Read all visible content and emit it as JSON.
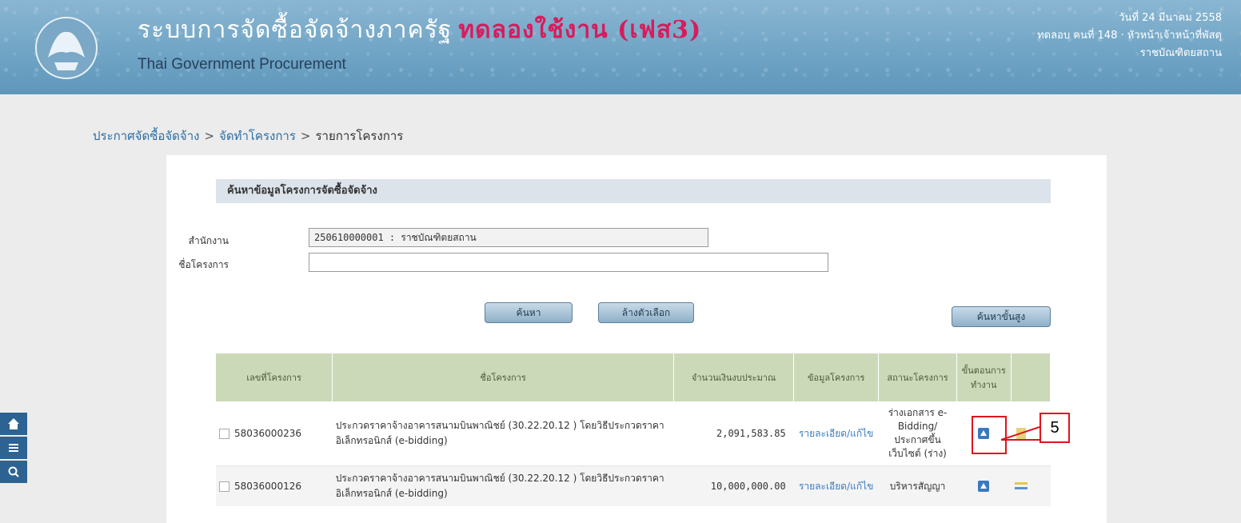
{
  "header": {
    "title_th": "ระบบการจัดซื้อจัดจ้างภาครัฐ",
    "title_tag": "ทดลองใช้งาน (เฟส3)",
    "title_en": "Thai Government Procurement",
    "date_line": "วันที่ 24 มีนาคม 2558",
    "user_line": "ทดลอบ คนที่ 148 · หัวหน้าเจ้าหน้าที่พัสดุ",
    "org_line": "ราชบัณฑิตยสถาน"
  },
  "breadcrumb": {
    "items": [
      "ประกาศจัดซื้อจัดจ้าง",
      "จัดทำโครงการ",
      "รายการโครงการ"
    ]
  },
  "search": {
    "section_title": "ค้นหาข้อมูลโครงการจัดซื้อจัดจ้าง",
    "agency_label": "สำนักงาน",
    "agency_value": "250610000001 : ราชบัณฑิตยสถาน",
    "project_label": "ชื่อโครงการ",
    "project_value": "",
    "btn_search": "ค้นหา",
    "btn_clear": "ล้างตัวเลือก",
    "btn_advanced": "ค้นหาขั้นสูง"
  },
  "table": {
    "headers": [
      "เลขที่โครงการ",
      "ชื่อโครงการ",
      "จำนวนเงินงบประมาณ",
      "ข้อมูลโครงการ",
      "สถานะโครงการ",
      "ขั้นตอนการทำงาน"
    ],
    "rows": [
      {
        "id": "58036000236",
        "name": "ประกวดราคาจ้างอาคารสนามบินพาณิชย์ (30.22.20.12 ) โดยวิธีประกวดราคาอิเล็กทรอนิกส์ (e-bidding)",
        "amount": "2,091,583.85",
        "info": "รายละเอียด/แก้ไข",
        "status": "ร่างเอกสาร e-Bidding/ ประกาศขึ้น เว็บไซต์ (ร่าง)"
      },
      {
        "id": "58036000126",
        "name": "ประกวดราคาจ้างอาคารสนามบินพาณิชย์ (30.22.20.12 ) โดยวิธีประกวดราคาอิเล็กทรอนิกส์ (e-bidding)",
        "amount": "10,000,000.00",
        "info": "รายละเอียด/แก้ไข",
        "status": "บริหารสัญญา"
      }
    ]
  },
  "callout": {
    "label": "5",
    "color": "#e0121d"
  },
  "side_icons": [
    "home-icon",
    "menu-icon",
    "search-icon"
  ]
}
